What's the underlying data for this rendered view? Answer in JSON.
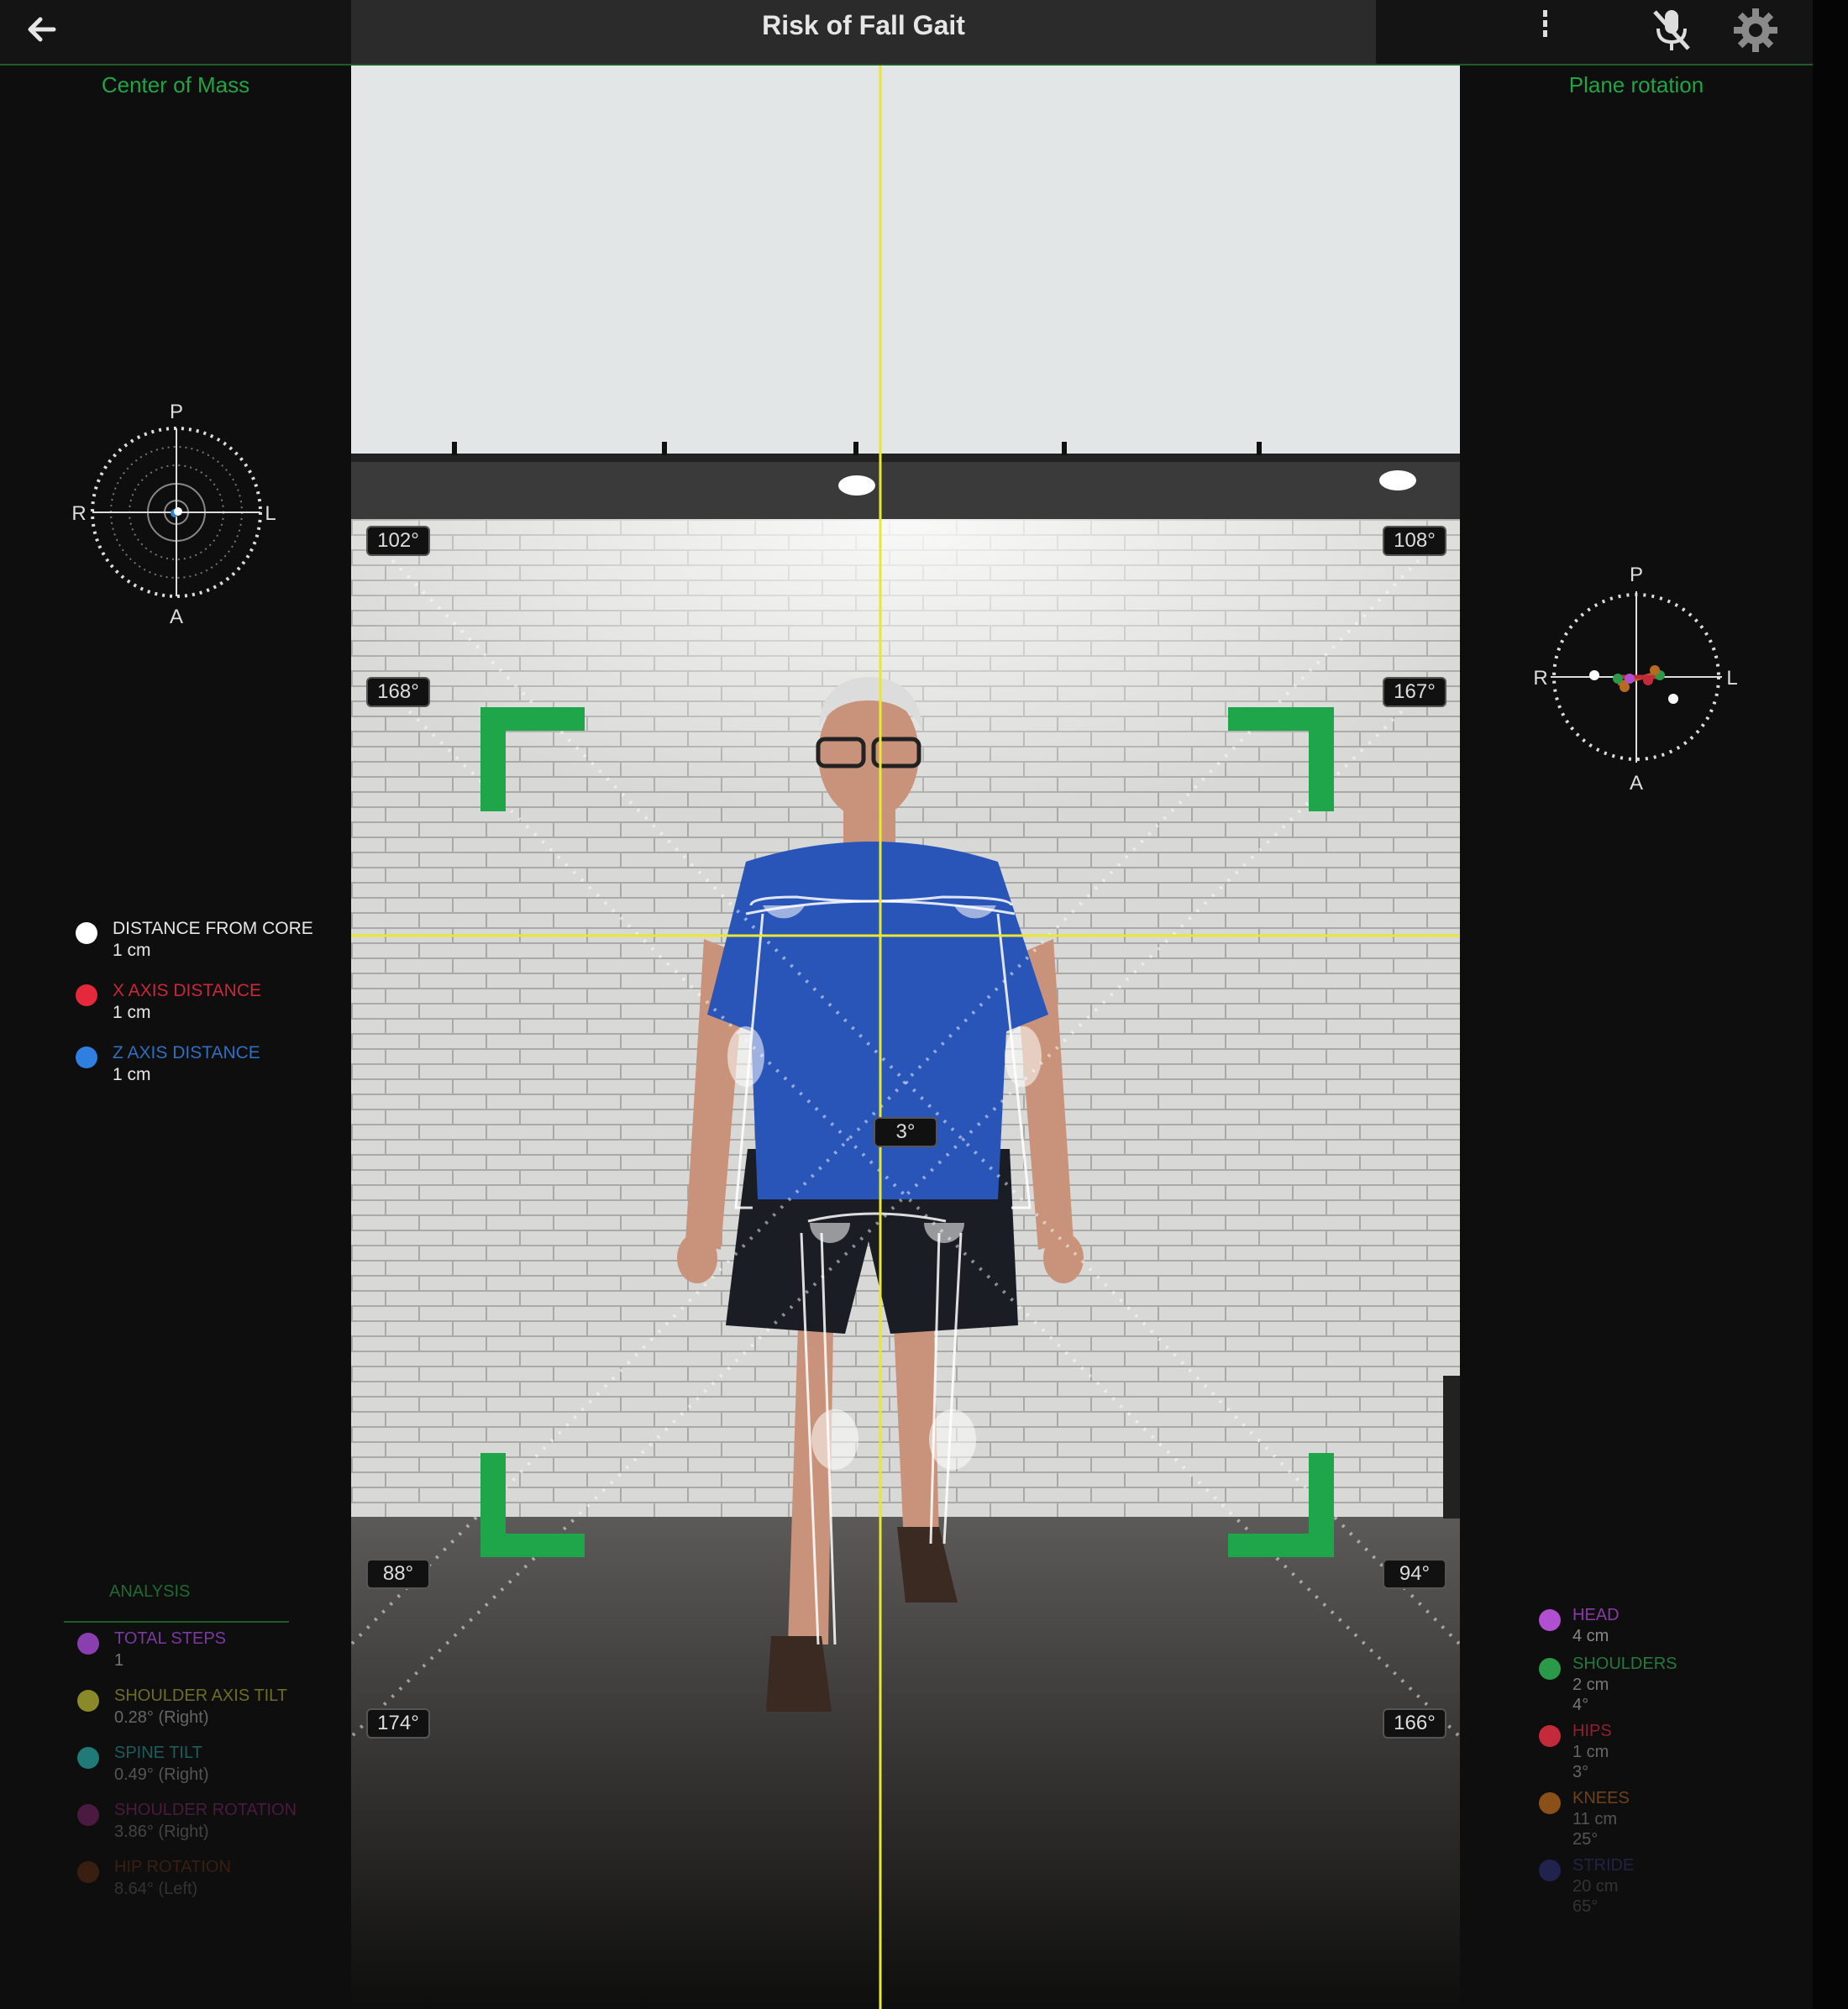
{
  "app": {
    "title": "Risk of Fall Gait"
  },
  "left_panel": {
    "title": "Center of Mass",
    "compass": {
      "top": "P",
      "bottom": "A",
      "left": "R",
      "right": "L"
    },
    "legend": [
      {
        "label": "DISTANCE FROM CORE",
        "value": "1 cm",
        "color": "#ffffff"
      },
      {
        "label": "X AXIS DISTANCE",
        "value": "1 cm",
        "color": "#e5283c"
      },
      {
        "label": "Z AXIS DISTANCE",
        "value": "1 cm",
        "color": "#2f7fe0"
      }
    ],
    "analysis": {
      "title": "ANALYSIS",
      "items": [
        {
          "label": "TOTAL STEPS",
          "value": "1",
          "color": "#8a3fb0"
        },
        {
          "label": "SHOULDER AXIS TILT",
          "value": "0.28° (Right)",
          "color": "#8a8a2a"
        },
        {
          "label": "SPINE TILT",
          "value": "0.49° (Right)",
          "color": "#1f7a78"
        },
        {
          "label": "SHOULDER ROTATION",
          "value": "3.86° (Right)",
          "color": "#6a1f5a"
        },
        {
          "label": "HIP ROTATION",
          "value": "8.64° (Left)",
          "color": "#5a2a1a"
        }
      ]
    }
  },
  "right_panel": {
    "title": "Plane rotation",
    "compass": {
      "top": "P",
      "bottom": "A",
      "left": "R",
      "right": "L"
    },
    "items": [
      {
        "label": "HEAD",
        "values": [
          "4 cm"
        ],
        "color": "#b04fd0"
      },
      {
        "label": "SHOULDERS",
        "values": [
          "2 cm",
          "4°"
        ],
        "color": "#2a9a4a"
      },
      {
        "label": "HIPS",
        "values": [
          "1 cm",
          "3°"
        ],
        "color": "#c42a3a"
      },
      {
        "label": "KNEES",
        "values": [
          "11 cm",
          "25°"
        ],
        "color": "#b86a20"
      },
      {
        "label": "STRIDE",
        "values": [
          "20 cm",
          "65°"
        ],
        "color": "#2a2a6a"
      }
    ]
  },
  "video": {
    "angles": {
      "top_left": "102°",
      "top_right": "108°",
      "upper_left": "168°",
      "upper_right": "167°",
      "center": "3°",
      "lower_left": "88°",
      "lower_right": "94°",
      "bottom_left": "174°",
      "bottom_right": "166°"
    },
    "frame_color": "#1fa64a",
    "axis_color": "#e8e830"
  },
  "icons": {
    "back": "back-arrow-icon",
    "more": "more-vertical-icon",
    "mic": "mic-off-icon",
    "settings": "gear-icon"
  }
}
